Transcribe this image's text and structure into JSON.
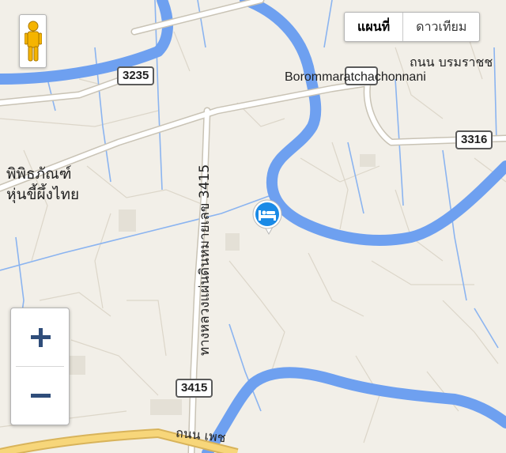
{
  "map_type": {
    "map_label": "แผนที่",
    "satellite_label": "ดาวเทียม",
    "selected": "map"
  },
  "route_shields": [
    {
      "id": "shield-3235",
      "number": "3235"
    },
    {
      "id": "shield-3316",
      "number": "3316"
    },
    {
      "id": "shield-3415",
      "number": "3415"
    },
    {
      "id": "shield-top",
      "number": ""
    }
  ],
  "labels": {
    "borommaratchachonnani": "Borommaratchachonnani",
    "road_thai_top": "ถนน บรมราชช",
    "museum_line1": "พิพิธภัณฑ์",
    "museum_line2": "หุ่นขี้ผึ้งไทย",
    "highway_vertical": "ทางหลวงแผ่นดินหมายเลข 3415",
    "road_bottom": "ถนน เพช"
  },
  "marker": {
    "type": "hotel",
    "icon": "bed-icon",
    "color": "#1a8ae6"
  },
  "zoom_controls": {
    "in_icon": "plus-icon",
    "out_icon": "minus-icon"
  },
  "colors": {
    "land": "#f2efe8",
    "water": "#6ea0f0",
    "road": "#ffffff",
    "road_outline": "#c9c3b5",
    "highway": "#f7d67a"
  }
}
